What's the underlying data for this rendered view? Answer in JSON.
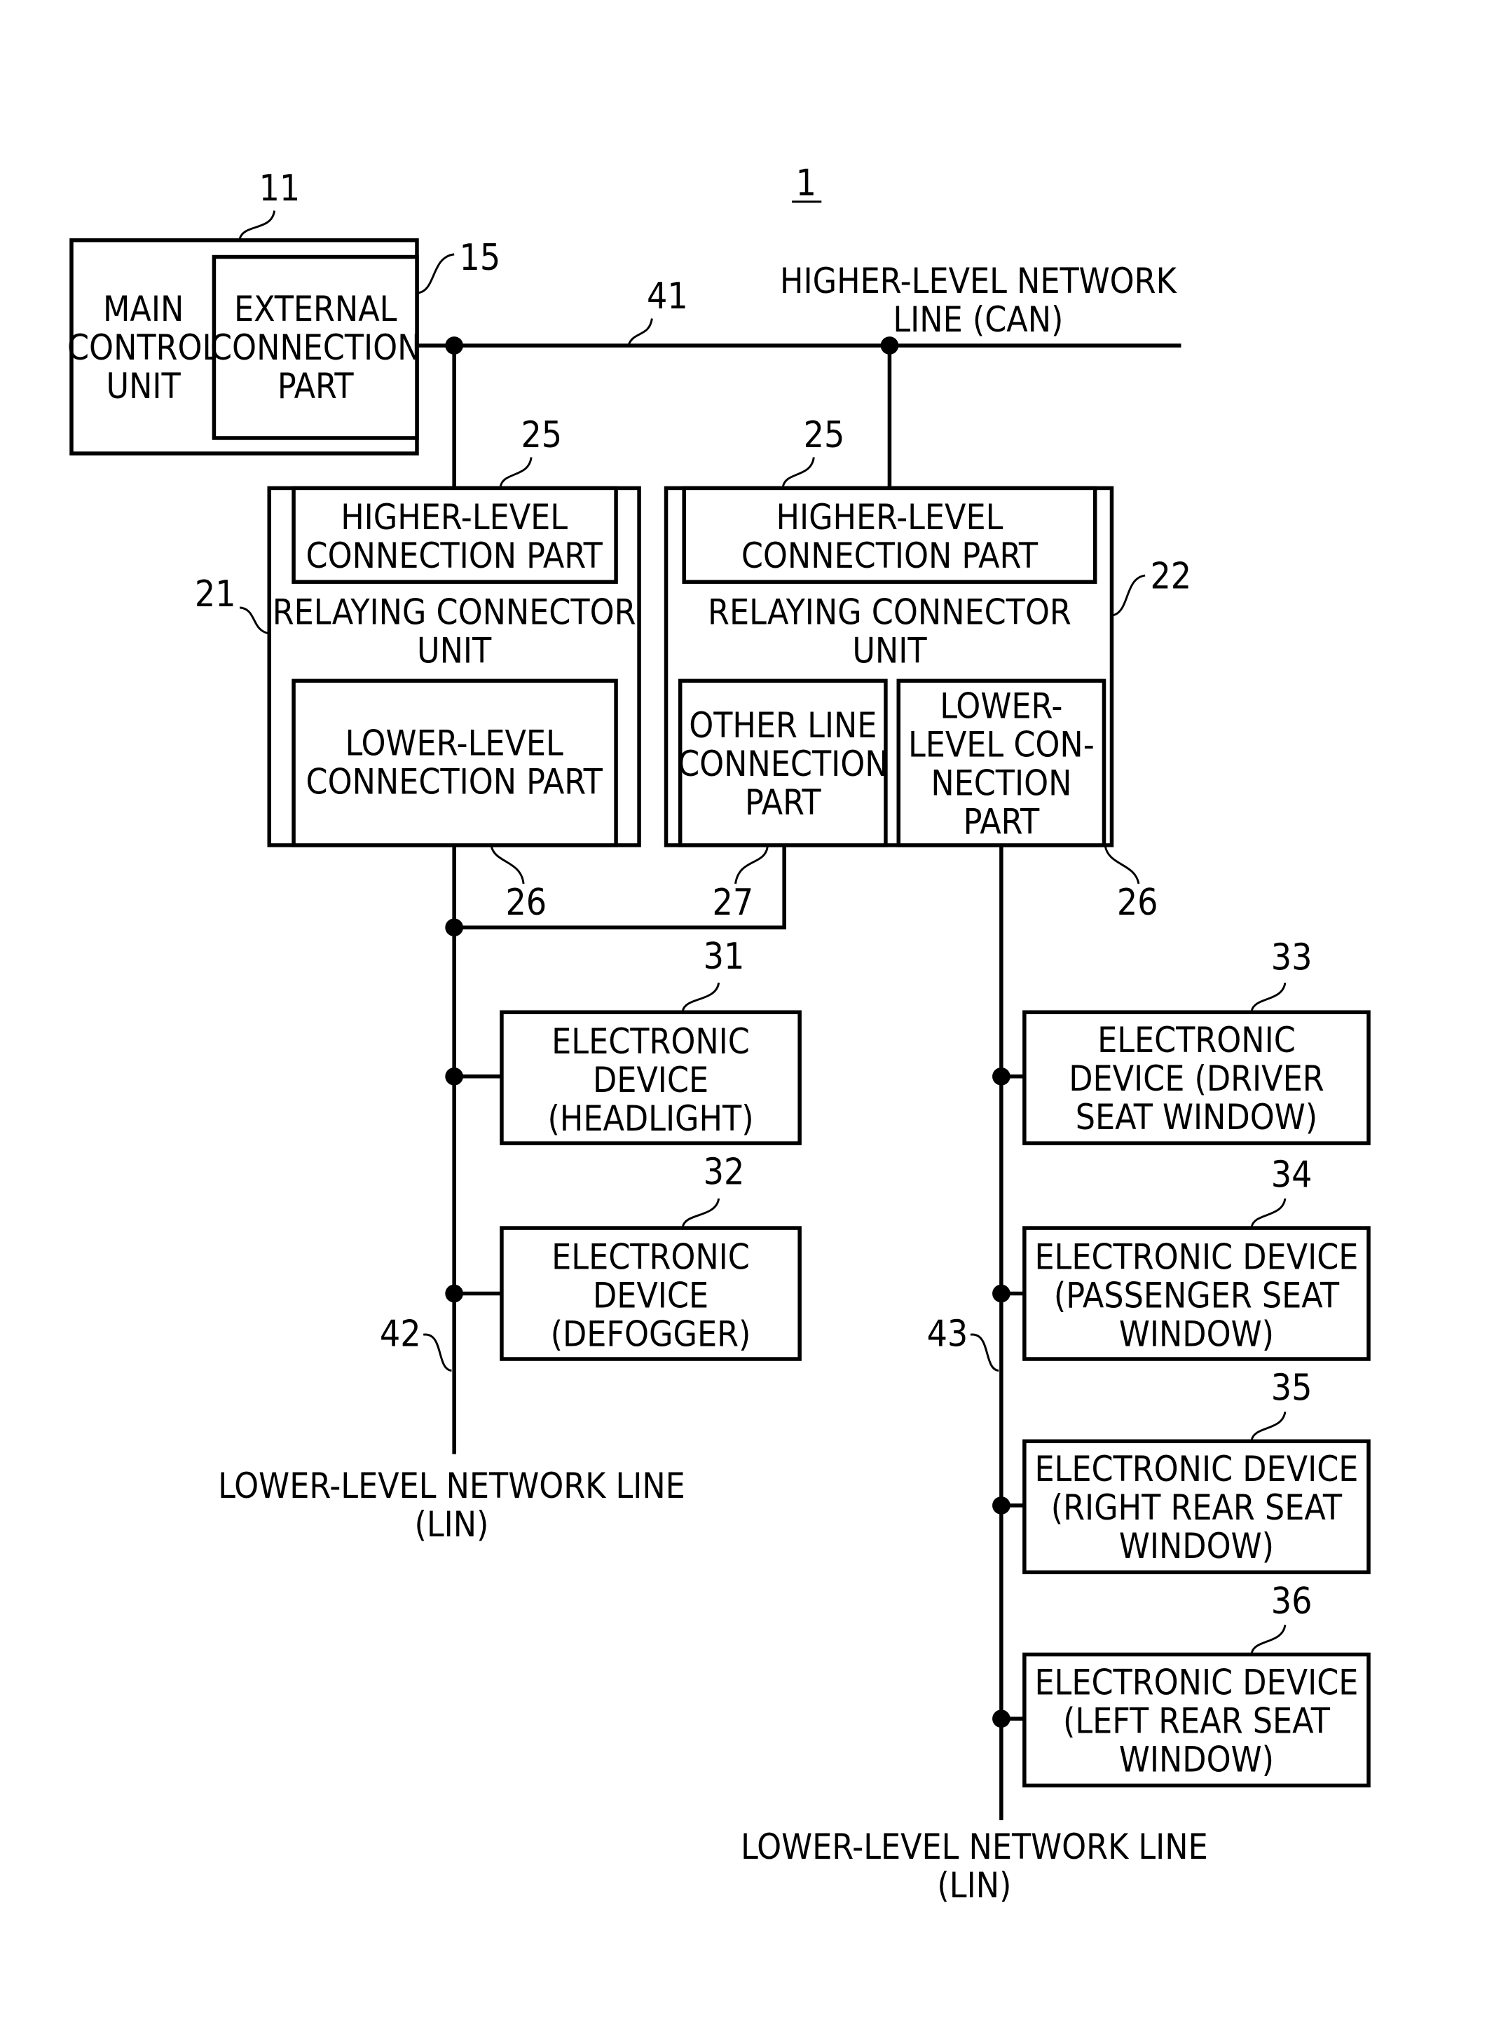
{
  "figure": {
    "number": "1",
    "nodes": {
      "main_control_unit": {
        "ref": "11",
        "lines": [
          "MAIN",
          "CONTROL",
          "UNIT"
        ]
      },
      "external_connection_part": {
        "ref": "15",
        "lines": [
          "EXTERNAL",
          "CONNECTION",
          "PART"
        ]
      },
      "relay_unit_left": {
        "ref": "21",
        "lines": [
          "RELAYING CONNECTOR",
          "UNIT"
        ],
        "higher_part": {
          "ref": "25",
          "lines": [
            "HIGHER-LEVEL",
            "CONNECTION PART"
          ]
        },
        "lower_part": {
          "ref": "26",
          "lines": [
            "LOWER-LEVEL",
            "CONNECTION PART"
          ]
        }
      },
      "relay_unit_right": {
        "ref": "22",
        "lines": [
          "RELAYING CONNECTOR",
          "UNIT"
        ],
        "higher_part": {
          "ref": "25",
          "lines": [
            "HIGHER-LEVEL",
            "CONNECTION PART"
          ]
        },
        "other_line_part": {
          "ref": "27",
          "lines": [
            "OTHER LINE",
            "CONNECTION",
            "PART"
          ]
        },
        "lower_part": {
          "ref": "26",
          "lines": [
            "LOWER-",
            "LEVEL CON-",
            "NECTION",
            "PART"
          ]
        }
      },
      "devices_left": [
        {
          "ref": "31",
          "lines": [
            "ELECTRONIC",
            "DEVICE",
            "(HEADLIGHT)"
          ]
        },
        {
          "ref": "32",
          "lines": [
            "ELECTRONIC",
            "DEVICE",
            "(DEFOGGER)"
          ]
        }
      ],
      "devices_right": [
        {
          "ref": "33",
          "lines": [
            "ELECTRONIC",
            "DEVICE (DRIVER",
            "SEAT WINDOW)"
          ]
        },
        {
          "ref": "34",
          "lines": [
            "ELECTRONIC DEVICE",
            "(PASSENGER SEAT",
            "WINDOW)"
          ]
        },
        {
          "ref": "35",
          "lines": [
            "ELECTRONIC DEVICE",
            "(RIGHT REAR SEAT",
            "WINDOW)"
          ]
        },
        {
          "ref": "36",
          "lines": [
            "ELECTRONIC DEVICE",
            "(LEFT REAR SEAT",
            "WINDOW)"
          ]
        }
      ]
    },
    "lines": {
      "higher_network": {
        "ref": "41",
        "lines": [
          "HIGHER-LEVEL NETWORK",
          "LINE (CAN)"
        ]
      },
      "lower_network_left": {
        "ref": "42",
        "lines": [
          "LOWER-LEVEL NETWORK LINE",
          "(LIN)"
        ]
      },
      "lower_network_right": {
        "ref": "43",
        "lines": [
          "LOWER-LEVEL NETWORK LINE",
          "(LIN)"
        ]
      }
    }
  }
}
